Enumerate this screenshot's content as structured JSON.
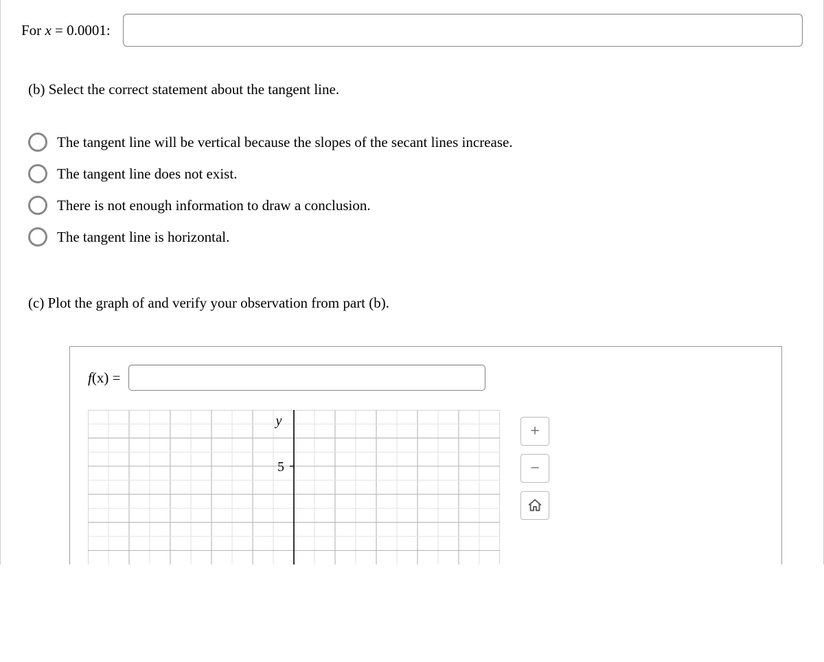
{
  "partA": {
    "label_prefix": "For ",
    "label_var": "x",
    "label_rest": " = 0.0001:"
  },
  "partB": {
    "prompt": "(b) Select the correct statement about the tangent line.",
    "options": [
      "The tangent line will be vertical because the slopes of the secant lines increase.",
      "The tangent line does not exist.",
      "There is not enough information to draw a conclusion.",
      "The tangent line is horizontal."
    ]
  },
  "partC": {
    "prompt": "(c) Plot the graph of and verify your observation from part (b).",
    "fx_label_f": "f",
    "fx_label_x": "(x) = "
  },
  "chart_data": {
    "type": "line",
    "title": "",
    "xlabel": "",
    "ylabel": "y",
    "xlim": [
      -5,
      5
    ],
    "ylim": [
      0,
      7
    ],
    "y_tick_visible": [
      5
    ],
    "grid": true,
    "series": []
  },
  "zoom": {
    "in": "+",
    "out": "−"
  }
}
